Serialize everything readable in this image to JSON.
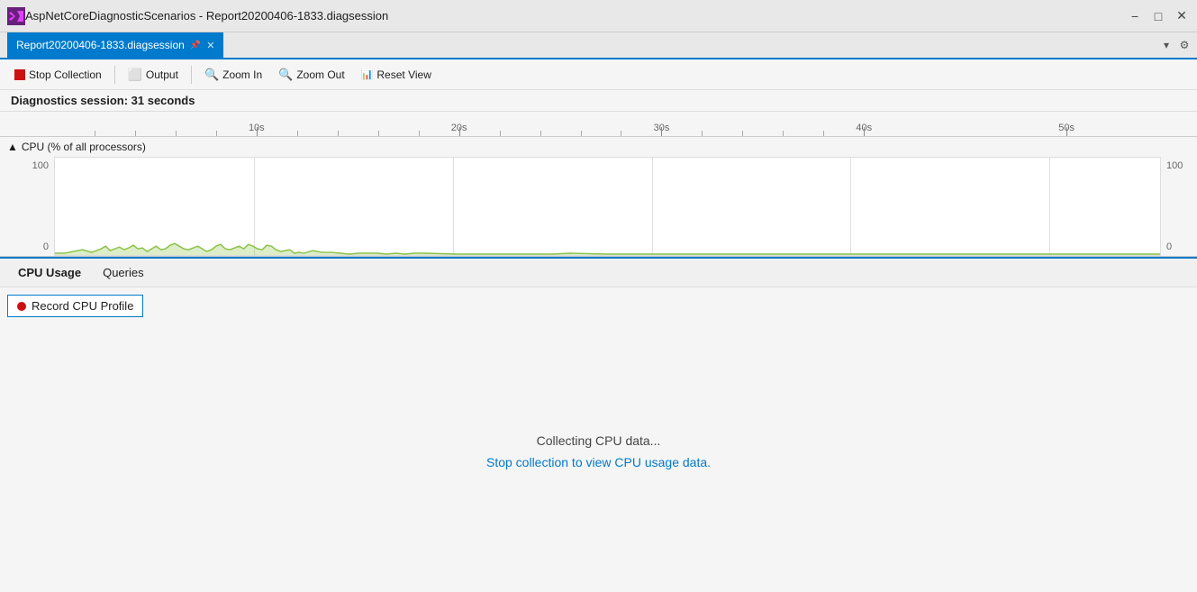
{
  "titlebar": {
    "app_title": "AspNetCoreDiagnosticScenarios - Report20200406-1833.diagsession",
    "icon_text": "VS",
    "minimize": "−",
    "maximize": "□",
    "close": "✕"
  },
  "tabbar": {
    "tab_name": "Report20200406-1833.diagsession",
    "pin_icon": "⊞",
    "close_icon": "✕",
    "dropdown_icon": "▾",
    "settings_icon": "⚙"
  },
  "toolbar": {
    "stop_collection": "Stop Collection",
    "output": "Output",
    "zoom_in": "Zoom In",
    "zoom_out": "Zoom Out",
    "reset_view": "Reset View"
  },
  "status": {
    "text": "Diagnostics session: 31 seconds"
  },
  "ruler": {
    "labels": [
      "10s",
      "20s",
      "30s",
      "40s",
      "50s"
    ],
    "label_positions": [
      18,
      36,
      54,
      72,
      90
    ]
  },
  "chart": {
    "title": "CPU (% of all processors)",
    "y_max": "100",
    "y_min": "0",
    "y_max_right": "100",
    "y_min_right": "0",
    "triangle_icon": "▲"
  },
  "bottomTabs": {
    "tabs": [
      {
        "id": "cpu-usage",
        "label": "CPU Usage",
        "active": true
      },
      {
        "id": "queries",
        "label": "Queries",
        "active": false
      }
    ]
  },
  "recordBtn": {
    "label": "Record CPU Profile",
    "dot_icon": "●"
  },
  "centerMessage": {
    "line1": "Collecting CPU data...",
    "line2": "Stop collection to view CPU usage data."
  }
}
